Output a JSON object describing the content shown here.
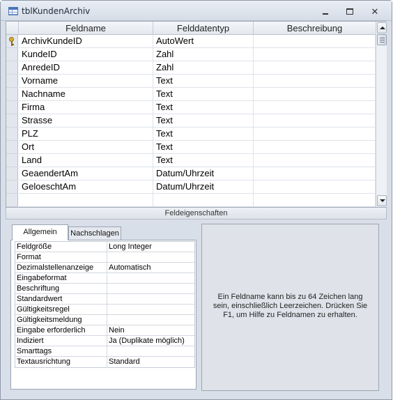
{
  "window": {
    "title": "tblKundenArchiv"
  },
  "grid": {
    "headers": [
      "Feldname",
      "Felddatentyp",
      "Beschreibung"
    ],
    "rows": [
      {
        "name": "ArchivKundeID",
        "type": "AutoWert",
        "desc": "",
        "primary_key": true
      },
      {
        "name": "KundeID",
        "type": "Zahl",
        "desc": ""
      },
      {
        "name": "AnredeID",
        "type": "Zahl",
        "desc": ""
      },
      {
        "name": "Vorname",
        "type": "Text",
        "desc": ""
      },
      {
        "name": "Nachname",
        "type": "Text",
        "desc": ""
      },
      {
        "name": "Firma",
        "type": "Text",
        "desc": ""
      },
      {
        "name": "Strasse",
        "type": "Text",
        "desc": ""
      },
      {
        "name": "PLZ",
        "type": "Text",
        "desc": ""
      },
      {
        "name": "Ort",
        "type": "Text",
        "desc": ""
      },
      {
        "name": "Land",
        "type": "Text",
        "desc": ""
      },
      {
        "name": "GeaendertAm",
        "type": "Datum/Uhrzeit",
        "desc": ""
      },
      {
        "name": "GeloeschtAm",
        "type": "Datum/Uhrzeit",
        "desc": ""
      },
      {
        "name": "",
        "type": "",
        "desc": ""
      }
    ]
  },
  "section_label": "Feldeigenschaften",
  "tabs": {
    "general": "Allgemein",
    "lookup": "Nachschlagen"
  },
  "properties": [
    {
      "label": "Feldgröße",
      "value": "Long Integer"
    },
    {
      "label": "Format",
      "value": ""
    },
    {
      "label": "Dezimalstellenanzeige",
      "value": "Automatisch"
    },
    {
      "label": "Eingabeformat",
      "value": ""
    },
    {
      "label": "Beschriftung",
      "value": ""
    },
    {
      "label": "Standardwert",
      "value": ""
    },
    {
      "label": "Gültigkeitsregel",
      "value": ""
    },
    {
      "label": "Gültigkeitsmeldung",
      "value": ""
    },
    {
      "label": "Eingabe erforderlich",
      "value": "Nein"
    },
    {
      "label": "Indiziert",
      "value": "Ja (Duplikate möglich)"
    },
    {
      "label": "Smarttags",
      "value": ""
    },
    {
      "label": "Textausrichtung",
      "value": "Standard"
    }
  ],
  "help": "Ein Feldname kann bis zu 64 Zeichen lang sein, einschließlich Leerzeichen. Drücken Sie F1, um Hilfe zu Feldnamen zu erhalten.",
  "icons": {
    "title": "table-icon",
    "primary_key": "key-icon"
  }
}
